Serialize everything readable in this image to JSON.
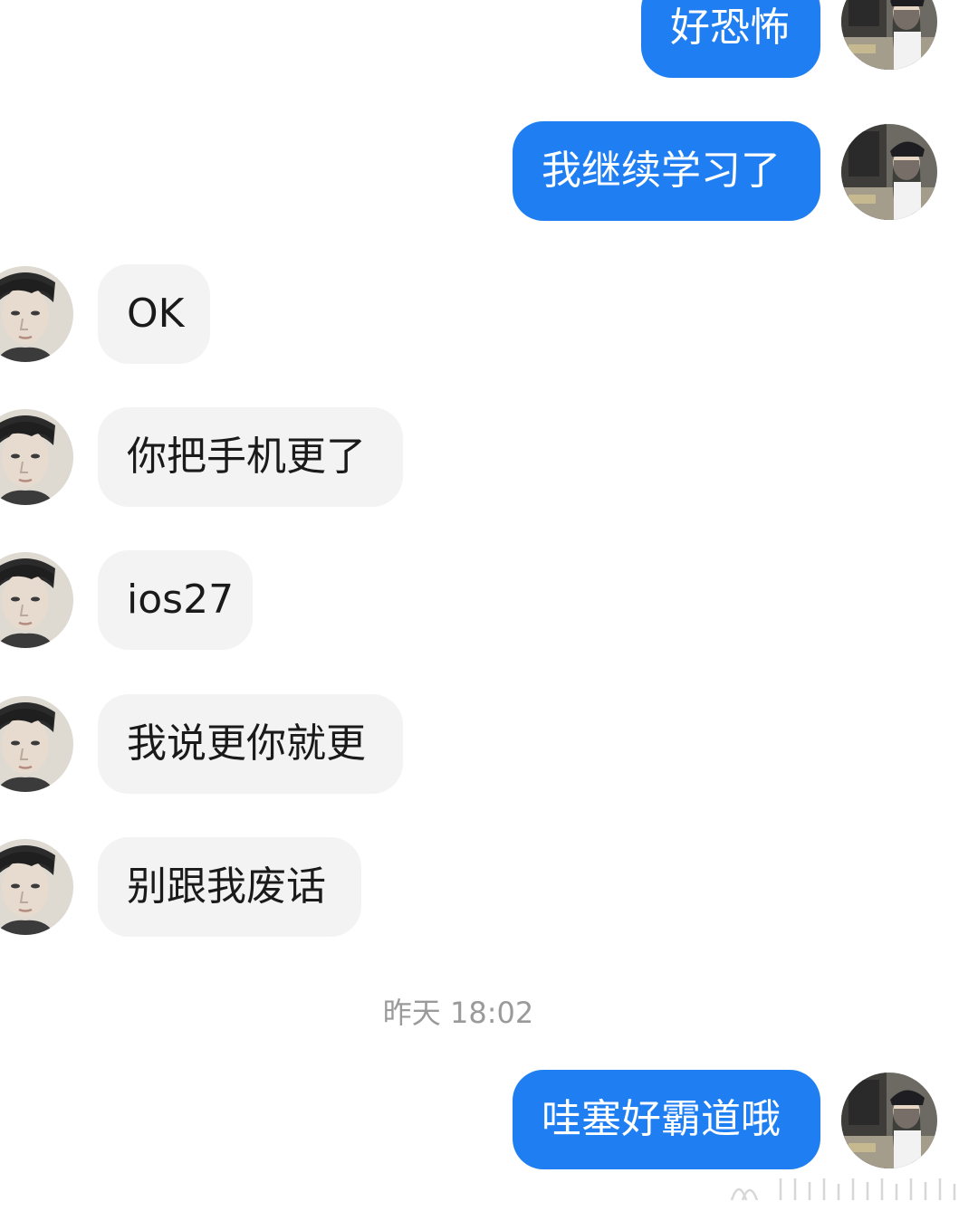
{
  "messages": [
    {
      "side": "out",
      "text": "好恐怖"
    },
    {
      "side": "out",
      "text": "我继续学习了"
    },
    {
      "side": "in",
      "text": "OK"
    },
    {
      "side": "in",
      "text": "你把手机更了"
    },
    {
      "side": "in",
      "text": "ios27"
    },
    {
      "side": "in",
      "text": "我说更你就更"
    },
    {
      "side": "in",
      "text": "别跟我废话"
    },
    {
      "side": "out",
      "text": "哇塞好霸道哦"
    }
  ],
  "timestamp": "昨天 18:02",
  "colors": {
    "outgoing_bubble": "#1f7ef2",
    "incoming_bubble": "#f3f3f3",
    "timestamp_text": "#9a9a9a",
    "background": "#ffffff"
  }
}
